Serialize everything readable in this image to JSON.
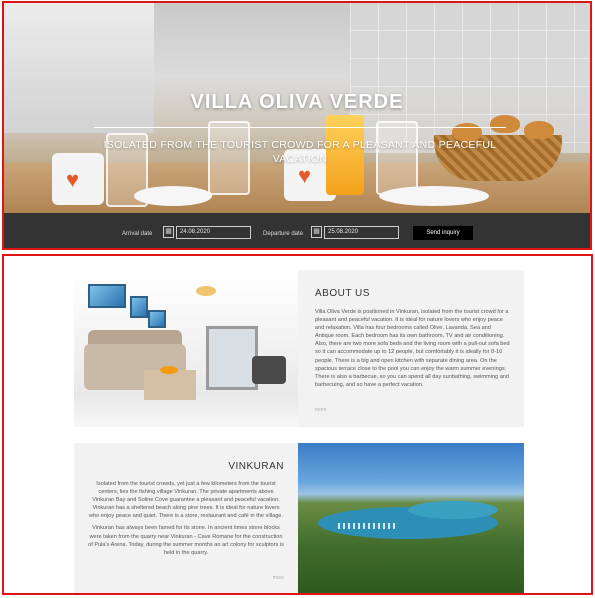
{
  "hero": {
    "title": "VILLA OLIVA VERDE",
    "subtitle": "ISOLATED FROM THE TOURIST CROWD FOR A PLEASANT AND PEACEFUL VACATION"
  },
  "booking": {
    "arrival_label": "Arrival date",
    "arrival_value": "24.08.2020",
    "departure_label": "Departure date",
    "departure_value": "25.08.2020",
    "button_label": "Send inquiry"
  },
  "about": {
    "title": "ABOUT US",
    "body": "Villa Oliva Verde is positioned in Vinkuran, isolated from the tourist crowd for a pleasant and peaceful vacation. It is ideal for nature lovers who enjoy peace and relaxation. Villa has four bedrooms called Olive, Lavanda, Sea and Antique room. Each bedroom has its own bathroom, TV and air conditioning. Also, there are two more sofa beds and the living room with a pull-out sofa bed so it can accommodate up to 12 people, but comfortably it is ideally for 8-10 people. There is a big and open kitchen with separate dining area. On the spacious terrace close to the pool you can enjoy the warm summer evenings. There is also a barbecue, so you can spend all day sunbathing, swimming and barbecuing, and so have a perfect vacation.",
    "more": "more"
  },
  "vinkuran": {
    "title": "VINKURAN",
    "body1": "Isolated from the tourist crowds, yet just a few kilometers from the tourist centers, lies the fishing village Vinkuran. The private apartments above Vinkuran Bay and Soline Cove guarantee a pleasant and peaceful vacation. Vinkuran has a sheltered beach along pine trees. It is ideal for nature lovers who enjoy peace and quiet. There is a store, restaurant and café in the village.",
    "body2": "Vinkuran has always been famed for its stone. In ancient times stone blocks were taken from the quarry near Vinkuran - Cave Romane for the construction of Pula's Arena. Today, during the summer months an art colony for sculptors is held in the quarry.",
    "more": "more"
  },
  "icons": {
    "calendar": "calendar-icon"
  },
  "colors": {
    "booking_bar": "#333333",
    "button": "#000000",
    "panel": "#f2f2f2",
    "highlight_border": "#e01414"
  }
}
